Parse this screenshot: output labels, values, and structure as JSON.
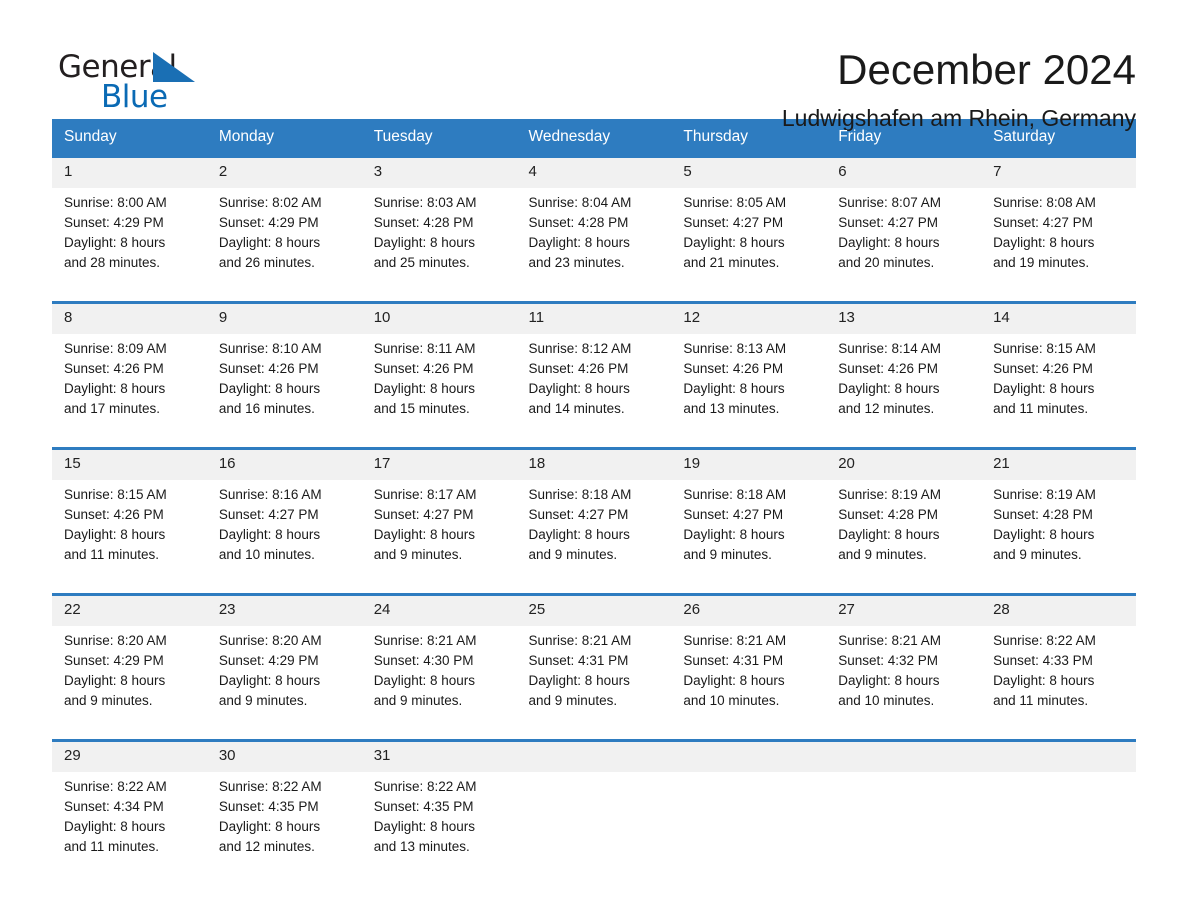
{
  "brand": {
    "name_top": "General",
    "name_bottom": "Blue",
    "triangle_color": "#1a6fb4",
    "text_color_top": "#231f20",
    "text_color_bottom": "#0a6ab4"
  },
  "header": {
    "month_title": "December 2024",
    "location": "Ludwigshafen am Rhein, Germany"
  },
  "theme": {
    "header_bg": "#2e7cc0",
    "header_text": "#ffffff",
    "daynum_bg": "#f1f1f1",
    "cell_bg": "#ffffff",
    "text": "#1a1a1a"
  },
  "calendar": {
    "weekday_headers": [
      "Sunday",
      "Monday",
      "Tuesday",
      "Wednesday",
      "Thursday",
      "Friday",
      "Saturday"
    ],
    "weeks": [
      {
        "days": [
          {
            "day": "1",
            "sunrise": "Sunrise: 8:00 AM",
            "sunset": "Sunset: 4:29 PM",
            "daylight_line1": "Daylight: 8 hours",
            "daylight_line2": "and 28 minutes."
          },
          {
            "day": "2",
            "sunrise": "Sunrise: 8:02 AM",
            "sunset": "Sunset: 4:29 PM",
            "daylight_line1": "Daylight: 8 hours",
            "daylight_line2": "and 26 minutes."
          },
          {
            "day": "3",
            "sunrise": "Sunrise: 8:03 AM",
            "sunset": "Sunset: 4:28 PM",
            "daylight_line1": "Daylight: 8 hours",
            "daylight_line2": "and 25 minutes."
          },
          {
            "day": "4",
            "sunrise": "Sunrise: 8:04 AM",
            "sunset": "Sunset: 4:28 PM",
            "daylight_line1": "Daylight: 8 hours",
            "daylight_line2": "and 23 minutes."
          },
          {
            "day": "5",
            "sunrise": "Sunrise: 8:05 AM",
            "sunset": "Sunset: 4:27 PM",
            "daylight_line1": "Daylight: 8 hours",
            "daylight_line2": "and 21 minutes."
          },
          {
            "day": "6",
            "sunrise": "Sunrise: 8:07 AM",
            "sunset": "Sunset: 4:27 PM",
            "daylight_line1": "Daylight: 8 hours",
            "daylight_line2": "and 20 minutes."
          },
          {
            "day": "7",
            "sunrise": "Sunrise: 8:08 AM",
            "sunset": "Sunset: 4:27 PM",
            "daylight_line1": "Daylight: 8 hours",
            "daylight_line2": "and 19 minutes."
          }
        ]
      },
      {
        "days": [
          {
            "day": "8",
            "sunrise": "Sunrise: 8:09 AM",
            "sunset": "Sunset: 4:26 PM",
            "daylight_line1": "Daylight: 8 hours",
            "daylight_line2": "and 17 minutes."
          },
          {
            "day": "9",
            "sunrise": "Sunrise: 8:10 AM",
            "sunset": "Sunset: 4:26 PM",
            "daylight_line1": "Daylight: 8 hours",
            "daylight_line2": "and 16 minutes."
          },
          {
            "day": "10",
            "sunrise": "Sunrise: 8:11 AM",
            "sunset": "Sunset: 4:26 PM",
            "daylight_line1": "Daylight: 8 hours",
            "daylight_line2": "and 15 minutes."
          },
          {
            "day": "11",
            "sunrise": "Sunrise: 8:12 AM",
            "sunset": "Sunset: 4:26 PM",
            "daylight_line1": "Daylight: 8 hours",
            "daylight_line2": "and 14 minutes."
          },
          {
            "day": "12",
            "sunrise": "Sunrise: 8:13 AM",
            "sunset": "Sunset: 4:26 PM",
            "daylight_line1": "Daylight: 8 hours",
            "daylight_line2": "and 13 minutes."
          },
          {
            "day": "13",
            "sunrise": "Sunrise: 8:14 AM",
            "sunset": "Sunset: 4:26 PM",
            "daylight_line1": "Daylight: 8 hours",
            "daylight_line2": "and 12 minutes."
          },
          {
            "day": "14",
            "sunrise": "Sunrise: 8:15 AM",
            "sunset": "Sunset: 4:26 PM",
            "daylight_line1": "Daylight: 8 hours",
            "daylight_line2": "and 11 minutes."
          }
        ]
      },
      {
        "days": [
          {
            "day": "15",
            "sunrise": "Sunrise: 8:15 AM",
            "sunset": "Sunset: 4:26 PM",
            "daylight_line1": "Daylight: 8 hours",
            "daylight_line2": "and 11 minutes."
          },
          {
            "day": "16",
            "sunrise": "Sunrise: 8:16 AM",
            "sunset": "Sunset: 4:27 PM",
            "daylight_line1": "Daylight: 8 hours",
            "daylight_line2": "and 10 minutes."
          },
          {
            "day": "17",
            "sunrise": "Sunrise: 8:17 AM",
            "sunset": "Sunset: 4:27 PM",
            "daylight_line1": "Daylight: 8 hours",
            "daylight_line2": "and 9 minutes."
          },
          {
            "day": "18",
            "sunrise": "Sunrise: 8:18 AM",
            "sunset": "Sunset: 4:27 PM",
            "daylight_line1": "Daylight: 8 hours",
            "daylight_line2": "and 9 minutes."
          },
          {
            "day": "19",
            "sunrise": "Sunrise: 8:18 AM",
            "sunset": "Sunset: 4:27 PM",
            "daylight_line1": "Daylight: 8 hours",
            "daylight_line2": "and 9 minutes."
          },
          {
            "day": "20",
            "sunrise": "Sunrise: 8:19 AM",
            "sunset": "Sunset: 4:28 PM",
            "daylight_line1": "Daylight: 8 hours",
            "daylight_line2": "and 9 minutes."
          },
          {
            "day": "21",
            "sunrise": "Sunrise: 8:19 AM",
            "sunset": "Sunset: 4:28 PM",
            "daylight_line1": "Daylight: 8 hours",
            "daylight_line2": "and 9 minutes."
          }
        ]
      },
      {
        "days": [
          {
            "day": "22",
            "sunrise": "Sunrise: 8:20 AM",
            "sunset": "Sunset: 4:29 PM",
            "daylight_line1": "Daylight: 8 hours",
            "daylight_line2": "and 9 minutes."
          },
          {
            "day": "23",
            "sunrise": "Sunrise: 8:20 AM",
            "sunset": "Sunset: 4:29 PM",
            "daylight_line1": "Daylight: 8 hours",
            "daylight_line2": "and 9 minutes."
          },
          {
            "day": "24",
            "sunrise": "Sunrise: 8:21 AM",
            "sunset": "Sunset: 4:30 PM",
            "daylight_line1": "Daylight: 8 hours",
            "daylight_line2": "and 9 minutes."
          },
          {
            "day": "25",
            "sunrise": "Sunrise: 8:21 AM",
            "sunset": "Sunset: 4:31 PM",
            "daylight_line1": "Daylight: 8 hours",
            "daylight_line2": "and 9 minutes."
          },
          {
            "day": "26",
            "sunrise": "Sunrise: 8:21 AM",
            "sunset": "Sunset: 4:31 PM",
            "daylight_line1": "Daylight: 8 hours",
            "daylight_line2": "and 10 minutes."
          },
          {
            "day": "27",
            "sunrise": "Sunrise: 8:21 AM",
            "sunset": "Sunset: 4:32 PM",
            "daylight_line1": "Daylight: 8 hours",
            "daylight_line2": "and 10 minutes."
          },
          {
            "day": "28",
            "sunrise": "Sunrise: 8:22 AM",
            "sunset": "Sunset: 4:33 PM",
            "daylight_line1": "Daylight: 8 hours",
            "daylight_line2": "and 11 minutes."
          }
        ]
      },
      {
        "days": [
          {
            "day": "29",
            "sunrise": "Sunrise: 8:22 AM",
            "sunset": "Sunset: 4:34 PM",
            "daylight_line1": "Daylight: 8 hours",
            "daylight_line2": "and 11 minutes."
          },
          {
            "day": "30",
            "sunrise": "Sunrise: 8:22 AM",
            "sunset": "Sunset: 4:35 PM",
            "daylight_line1": "Daylight: 8 hours",
            "daylight_line2": "and 12 minutes."
          },
          {
            "day": "31",
            "sunrise": "Sunrise: 8:22 AM",
            "sunset": "Sunset: 4:35 PM",
            "daylight_line1": "Daylight: 8 hours",
            "daylight_line2": "and 13 minutes."
          },
          {
            "day": "",
            "sunrise": "",
            "sunset": "",
            "daylight_line1": "",
            "daylight_line2": ""
          },
          {
            "day": "",
            "sunrise": "",
            "sunset": "",
            "daylight_line1": "",
            "daylight_line2": ""
          },
          {
            "day": "",
            "sunrise": "",
            "sunset": "",
            "daylight_line1": "",
            "daylight_line2": ""
          },
          {
            "day": "",
            "sunrise": "",
            "sunset": "",
            "daylight_line1": "",
            "daylight_line2": ""
          }
        ]
      }
    ]
  }
}
